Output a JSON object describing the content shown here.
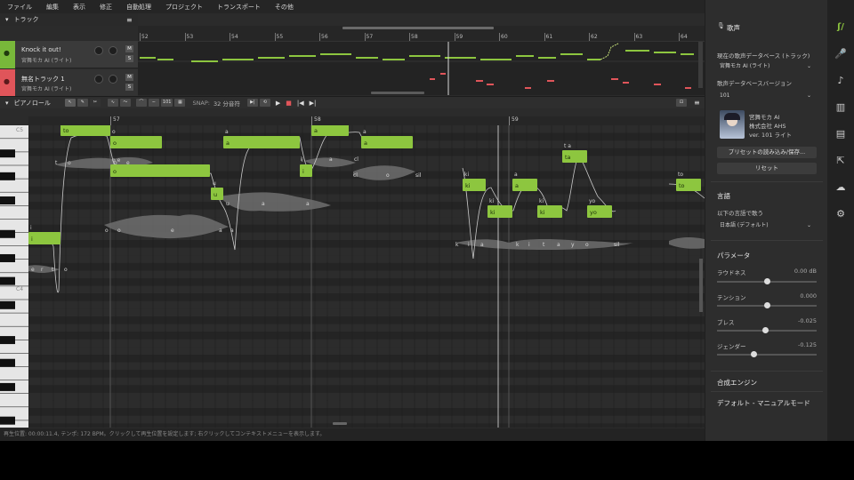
{
  "menu": [
    "ファイル",
    "編集",
    "表示",
    "修正",
    "自動処理",
    "プロジェクト",
    "トランスポート",
    "その他"
  ],
  "tracks_header": {
    "title": "トラック"
  },
  "tracks": [
    {
      "name": "Knock it out!",
      "voice": "宮舞モカ AI (ライト)",
      "color": "#78b83a",
      "mute": "M",
      "solo": "S"
    },
    {
      "name": "無名トラック 1",
      "voice": "宮舞モカ AI (ライト)",
      "color": "#e0555a",
      "mute": "M",
      "solo": "S"
    }
  ],
  "track_ruler": [
    "52",
    "53",
    "54",
    "55",
    "56",
    "57",
    "58",
    "59",
    "60",
    "61",
    "62",
    "63",
    "64"
  ],
  "piano_roll": {
    "title": "ピアノロール",
    "snap_label": "SNAP:",
    "snap_value": "32 分音符",
    "tool_101": "101",
    "ruler": [
      "57",
      "58",
      "59"
    ],
    "key_labels": [
      "C5",
      "C4"
    ]
  },
  "notes": [
    {
      "lyric": "to",
      "ph": "o",
      "ph_lyric": "t o"
    },
    {
      "lyric": "o",
      "ph": "",
      "ph_lyric": "o"
    },
    {
      "lyric": "o",
      "ph": "e",
      "ph_lyric": "o e"
    },
    {
      "lyric": "u",
      "ph": "",
      "ph_lyric": "u"
    },
    {
      "lyric": "a",
      "ph": "",
      "ph_lyric": "a"
    },
    {
      "lyric": "i",
      "ph": "",
      "ph_lyric": "i"
    },
    {
      "lyric": "a",
      "ph": "",
      "ph_lyric": "a"
    },
    {
      "lyric": "a",
      "ph": "",
      "ph_lyric": "a"
    },
    {
      "lyric": "ki",
      "ph": "",
      "ph_lyric": "ki"
    },
    {
      "lyric": "ki",
      "ph": "",
      "ph_lyric": "ki"
    },
    {
      "lyric": "a",
      "ph": "",
      "ph_lyric": "a"
    },
    {
      "lyric": "ki",
      "ph": "",
      "ph_lyric": "ki"
    },
    {
      "lyric": "ta",
      "ph": "",
      "ph_lyric": "t a"
    },
    {
      "lyric": "yo",
      "ph": "",
      "ph_lyric": "yo"
    },
    {
      "lyric": "to",
      "ph": "",
      "ph_lyric": "to"
    },
    {
      "lyric": "i",
      "ph": "",
      "ph_lyric": "i"
    }
  ],
  "phonemes": {
    "row1": [
      "o",
      "o",
      "e",
      "a",
      "a"
    ],
    "row2": [
      "k",
      "i",
      "a",
      "k",
      "i",
      "t",
      "a",
      "y",
      "o",
      "sil"
    ],
    "row3": [
      "e",
      "r",
      "t",
      "o"
    ],
    "row4": [
      "t",
      "o",
      "o",
      "e"
    ],
    "row5": [
      "cl",
      "o",
      "sil"
    ],
    "row6": [
      "u",
      "a",
      "a"
    ],
    "row7": [
      "i",
      "a",
      "cl"
    ]
  },
  "status": "再生位置: 00:00:11.4, テンポ: 172 BPM。クリックして再生位置を設定します; 右クリックしてコンテキストメニューを表示します。",
  "panel": {
    "header": "歌声",
    "db_track_label": "現在の歌声データベース (トラック)",
    "db_track_value": "宮舞モカ AI (ライト)",
    "db_version_label": "歌声データベースバージョン",
    "db_version_value": "101",
    "voice_name": "宮舞モカ AI",
    "voice_company": "株式会社 AHS",
    "voice_version": "ver. 101 ライト",
    "preset_button": "プリセットの読み込み/保存...",
    "reset_button": "リセット",
    "language_title": "言語",
    "language_label": "以下の言語で歌う",
    "language_value": "日本語 (デフォルト)",
    "params_title": "パラメータ",
    "params": [
      {
        "name": "ラウドネス",
        "value": "0.00 dB",
        "level": 0.5
      },
      {
        "name": "テンション",
        "value": "0.000",
        "level": 0.5
      },
      {
        "name": "ブレス",
        "value": "-0.025",
        "level": 0.49
      },
      {
        "name": "ジェンダー",
        "value": "-0.125",
        "level": 0.37
      }
    ],
    "engine_title": "合成エンジン",
    "engine_mode": "デフォルト - マニュアルモード"
  },
  "colors": {
    "accent": "#8cc63f",
    "note": "#8dc63f",
    "track2": "#e0555a"
  }
}
